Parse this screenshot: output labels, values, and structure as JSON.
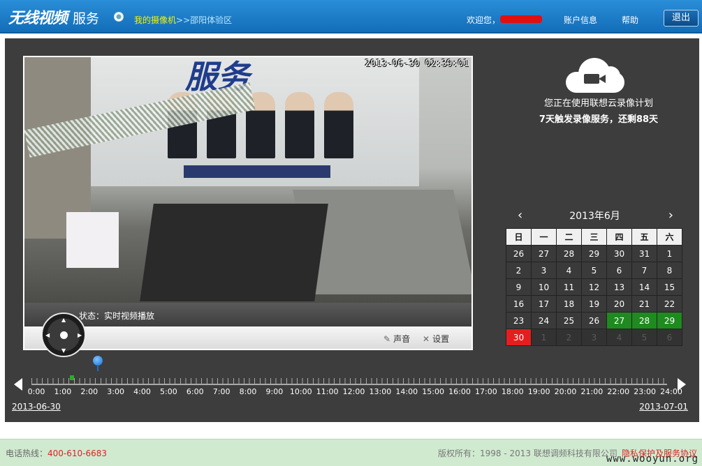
{
  "header": {
    "logo_text": "无线视频",
    "logo_sub": "服务",
    "crumb_camera": "我的摄像机",
    "crumb_sep": ">>",
    "crumb_location": "邵阳体验区",
    "welcome": "欢迎您，",
    "account_link": "账户信息",
    "help_link": "帮助",
    "logout_button": "退出"
  },
  "video": {
    "timestamp": "2013-06-30 02:39:01",
    "status": "状态：实时视频播放",
    "sound_label": "声音",
    "settings_label": "设置"
  },
  "plan": {
    "line1": "您正在使用联想云录像计划",
    "line2": "7天触发录像服务，还剩88天"
  },
  "calendar": {
    "month_label": "2013年6月",
    "weekdays": [
      "日",
      "一",
      "二",
      "三",
      "四",
      "五",
      "六"
    ],
    "rows": [
      [
        "26",
        "27",
        "28",
        "29",
        "30",
        "31",
        "1"
      ],
      [
        "2",
        "3",
        "4",
        "5",
        "6",
        "7",
        "8"
      ],
      [
        "9",
        "10",
        "11",
        "12",
        "13",
        "14",
        "15"
      ],
      [
        "16",
        "17",
        "18",
        "19",
        "20",
        "21",
        "22"
      ],
      [
        "23",
        "24",
        "25",
        "26",
        "27",
        "28",
        "29"
      ],
      [
        "30",
        "1",
        "2",
        "3",
        "4",
        "5",
        "6"
      ]
    ],
    "recorded_days": [
      "27",
      "28",
      "29"
    ],
    "today": "30",
    "colors": {
      "recorded": "#1f8a1f",
      "today": "#e41e1e"
    }
  },
  "timeline": {
    "hours": [
      "0:00",
      "1:00",
      "2:00",
      "3:00",
      "4:00",
      "5:00",
      "6:00",
      "7:00",
      "8:00",
      "9:00",
      "10:00",
      "11:00",
      "12:00",
      "13:00",
      "14:00",
      "15:00",
      "16:00",
      "17:00",
      "18:00",
      "19:00",
      "20:00",
      "21:00",
      "22:00",
      "23:00",
      "24:00"
    ],
    "start_date": "2013-06-30",
    "end_date": "2013-07-01"
  },
  "footer": {
    "hotline_label": "电话热线：",
    "hotline_number": "400-610-6683",
    "copyright": "版权所有：1998 - 2013 联想调频科技有限公司",
    "privacy": "隐私保护及服务协议",
    "watermark": "www.wooyun.org"
  }
}
